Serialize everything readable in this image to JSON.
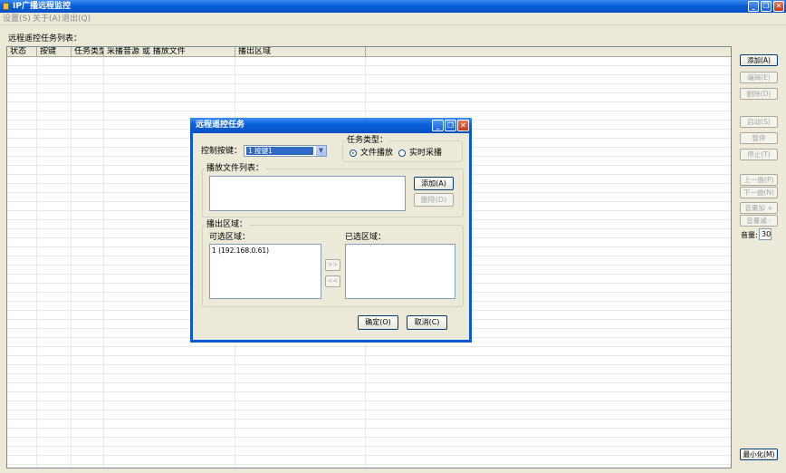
{
  "window": {
    "title": "IP广播远程监控",
    "min_glyph": "_",
    "max_glyph": "❐",
    "close_glyph": "✕"
  },
  "menu": {
    "settings": "设置(S)",
    "about": "关于(A)",
    "exit": "退出(Q)"
  },
  "main": {
    "list_caption": "远程遥控任务列表：",
    "columns": [
      "状态",
      "按键",
      "任务类型",
      "采播音源 或 播放文件",
      "播出区域"
    ]
  },
  "side_buttons": {
    "add": "添加(A)",
    "edit": "编辑(E)",
    "delete": "删除(D)",
    "start": "启动(S)",
    "pause": "暂停",
    "stop": "停止(T)",
    "prev": "上一曲(P)",
    "next": "下一曲(N)",
    "vol_up": "音量加 +",
    "vol_down": "音量减 -",
    "volume_label": "音量:",
    "volume_value": "30",
    "minimize": "最小化(M)"
  },
  "dialog": {
    "title": "远程遥控任务",
    "control_key_label": "控制按键：",
    "control_key_value": "1  按键1",
    "task_type_label": "任务类型：",
    "radio_file": "文件播放",
    "radio_realtime": "实时采播",
    "playlist_label": "播放文件列表：",
    "add_button": "添加(A)",
    "delete_button": "删除(D)",
    "output_label": "播出区域：",
    "available_label": "可选区域：",
    "selected_label": "已选区域：",
    "available_items": [
      "1 (192.168.0.61)"
    ],
    "move_right": ">>",
    "move_left": "<<",
    "ok": "确定(O)",
    "cancel": "取消(C)"
  }
}
